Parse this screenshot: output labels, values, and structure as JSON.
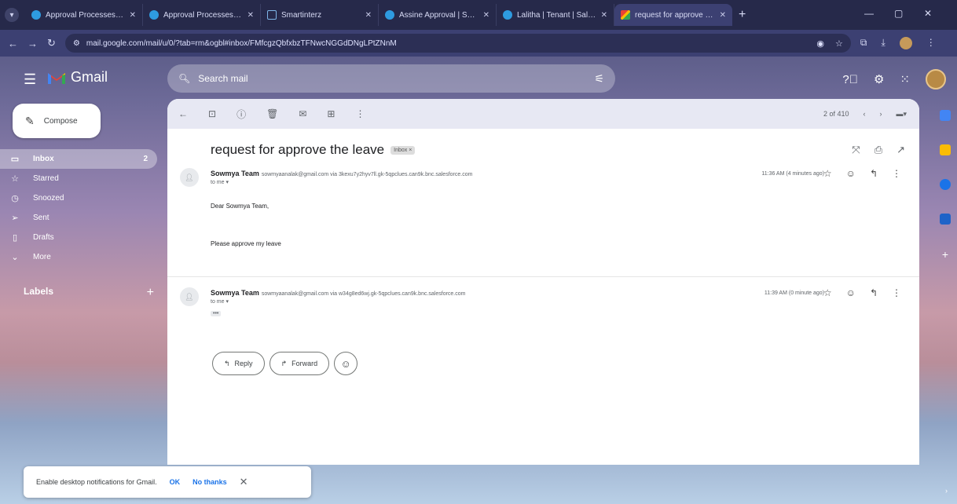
{
  "browser": {
    "tabs": [
      {
        "title": "Approval Processes | Sale",
        "icon": "salesforce-icon"
      },
      {
        "title": "Approval Processes | Sale",
        "icon": "salesforce-icon"
      },
      {
        "title": "Smartinterz",
        "icon": "page-icon"
      },
      {
        "title": "Assine Approval | Salesfor",
        "icon": "salesforce-icon"
      },
      {
        "title": "Lalitha | Tenant | Salesforce",
        "icon": "salesforce-icon"
      },
      {
        "title": "request for approve the l",
        "icon": "gmail-icon",
        "active": true
      }
    ],
    "url": "mail.google.com/mail/u/0/?tab=rm&ogbl#inbox/FMfcgzQbfxbzTFNwcNGGdDNgLPtZNnM"
  },
  "gmail": {
    "brand": "Gmail",
    "search_placeholder": "Search mail",
    "compose_label": "Compose",
    "nav": [
      {
        "label": "Inbox",
        "icon": "inbox-icon",
        "count": "2",
        "active": true
      },
      {
        "label": "Starred",
        "icon": "star-icon"
      },
      {
        "label": "Snoozed",
        "icon": "clock-icon"
      },
      {
        "label": "Sent",
        "icon": "send-icon"
      },
      {
        "label": "Drafts",
        "icon": "draft-icon"
      },
      {
        "label": "More",
        "icon": "chevron-down-icon"
      }
    ],
    "labels_heading": "Labels",
    "pagination": "2 of 410"
  },
  "thread": {
    "subject": "request for approve the leave",
    "inbox_chip": "Inbox ×",
    "messages": [
      {
        "sender": "Sowmya Team",
        "email": "sowmyaanalak@gmail.com via 3kexu7y2hyv7ll.gk-5qpclues.can9k.bnc.salesforce.com",
        "to": "to me ▾",
        "time": "11:36 AM (4 minutes ago)",
        "greeting": "Dear Sowmya Team,",
        "body": "Please approve my leave"
      },
      {
        "sender": "Sowmya Team",
        "email": "sowmyaanalak@gmail.com via w34g8ed6wj.gk-5qpclues.can9k.bnc.salesforce.com",
        "to": "to me ▾",
        "time": "11:39 AM (0 minute ago)",
        "trimmed": "•••"
      }
    ],
    "reply_label": "Reply",
    "forward_label": "Forward"
  },
  "notification": {
    "text": "Enable desktop notifications for Gmail.",
    "ok": "OK",
    "no_thanks": "No thanks"
  },
  "colors": {
    "accent_blue": "#1a73e8",
    "chrome_dark": "#26294a"
  }
}
